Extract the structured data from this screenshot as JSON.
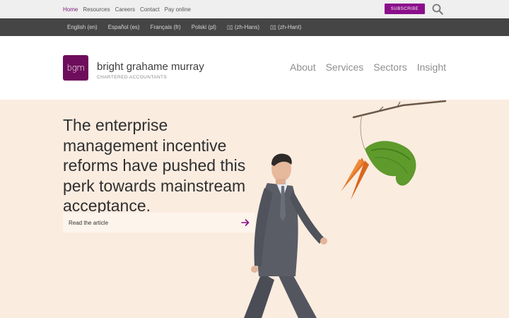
{
  "topnav": {
    "items": [
      "Home",
      "Resources",
      "Careers",
      "Contact",
      "Pay online"
    ],
    "active": "Home"
  },
  "subscribe_label": "SUBSCRIBE",
  "languages": [
    "English (en)",
    "Español (es)",
    "Français (fr)",
    "Polski (pl)",
    "▯▯ (zh-Hans)",
    "▯▯ (zh-Hant)"
  ],
  "brand": {
    "logo_text": "bgm",
    "name": "bright grahame murray",
    "subtitle": "CHARTERED ACCOUNTANTS"
  },
  "mainnav": [
    "About",
    "Services",
    "Sectors",
    "Insight"
  ],
  "hero": {
    "headline": "The enterprise management incentive reforms have pushed this perk towards mainstream acceptance.",
    "cta_label": "Read the article"
  },
  "colors": {
    "accent": "#8a0f8a",
    "logo_bg": "#6e0d5b",
    "hero_bg": "#fbece0",
    "langbar_bg": "#454545"
  }
}
